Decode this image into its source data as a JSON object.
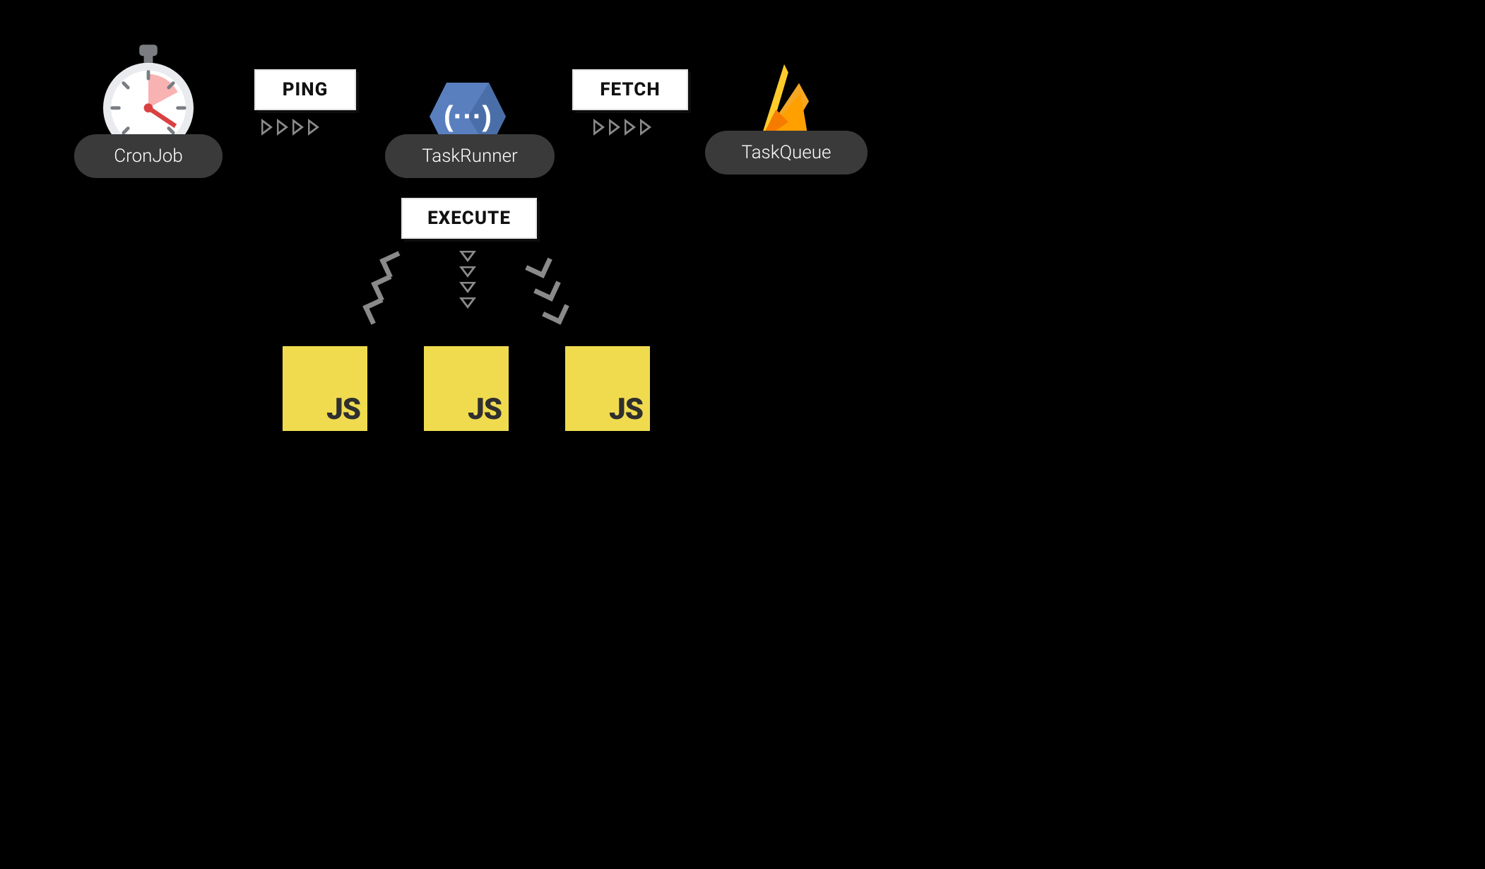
{
  "nodes": {
    "cronjob": {
      "label": "CronJob"
    },
    "taskrunner": {
      "label": "TaskRunner"
    },
    "taskqueue": {
      "label": "TaskQueue"
    }
  },
  "edges": {
    "ping": {
      "label": "PING",
      "from": "cronjob",
      "to": "taskrunner"
    },
    "fetch": {
      "label": "FETCH",
      "from": "taskrunner",
      "to": "taskqueue"
    },
    "execute": {
      "label": "EXECUTE",
      "from": "taskrunner",
      "to": "js_tasks"
    }
  },
  "tasks": {
    "js1": {
      "label": "JS"
    },
    "js2": {
      "label": "JS"
    },
    "js3": {
      "label": "JS"
    }
  },
  "icons": {
    "stopwatch": "stopwatch-icon",
    "cloudfunction": "cloud-function-icon",
    "firebase": "firebase-icon",
    "js": "javascript-icon"
  },
  "colors": {
    "bg": "#000000",
    "pill": "#3a3a3a",
    "arrow": "#8a8a8a",
    "js_bg": "#f0db4f",
    "js_fg": "#2f2f2f",
    "stopwatch_body": "#e9ebee",
    "stopwatch_wedge": "#f9b2b2",
    "stopwatch_hand": "#d94141",
    "taskrunner_blue": "#5a7fbf",
    "firebase_orange": "#f5a623",
    "firebase_yellow": "#ffcb2b",
    "firebase_red": "#f57c00"
  }
}
